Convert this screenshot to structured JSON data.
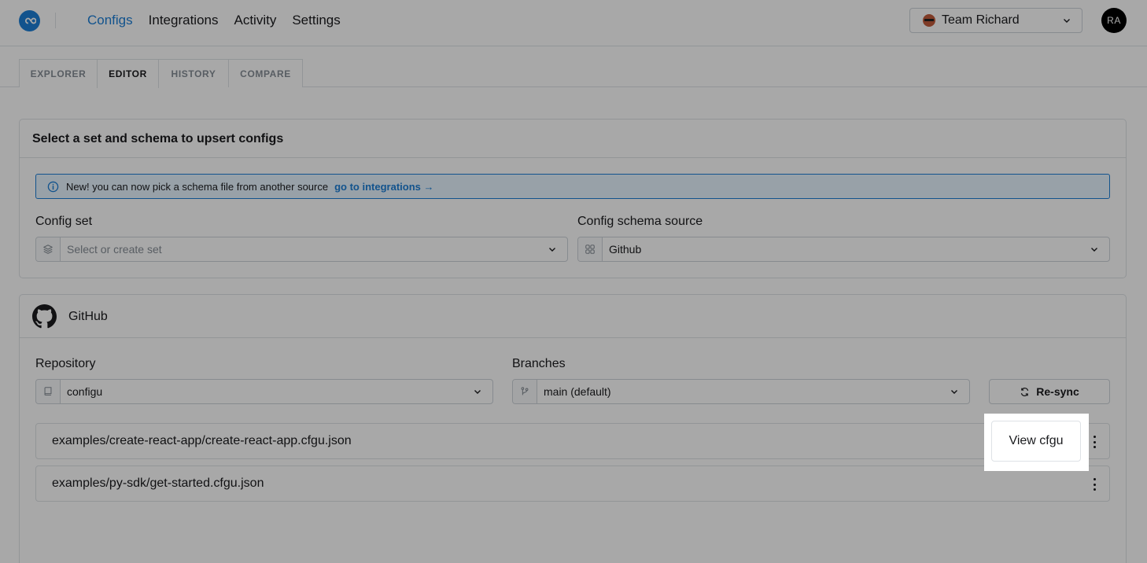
{
  "header": {
    "nav": [
      "Configs",
      "Integrations",
      "Activity",
      "Settings"
    ],
    "active_nav": "Configs",
    "team": "Team Richard",
    "user_initials": "RA"
  },
  "tabs": [
    "EXPLORER",
    "EDITOR",
    "HISTORY",
    "COMPARE"
  ],
  "active_tab": "EDITOR",
  "select_card": {
    "title": "Select a set and schema to upsert configs",
    "alert_text": "New! you can now pick a schema file from another source",
    "alert_link": "go to integrations →",
    "config_set_label": "Config set",
    "config_set_placeholder": "Select or create set",
    "schema_source_label": "Config schema source",
    "schema_source_value": "Github"
  },
  "github_card": {
    "title": "GitHub",
    "repository_label": "Repository",
    "repository_value": "configu",
    "branches_label": "Branches",
    "branch_value": "main (default)",
    "resync_label": "Re-sync",
    "files": [
      "examples/create-react-app/create-react-app.cfgu.json",
      "examples/py-sdk/get-started.cfgu.json"
    ]
  },
  "popover": {
    "label": "View cfgu"
  },
  "colors": {
    "accent": "#1c7ed6",
    "alert_bg": "#e7f5ff",
    "border": "#dee2e6"
  }
}
